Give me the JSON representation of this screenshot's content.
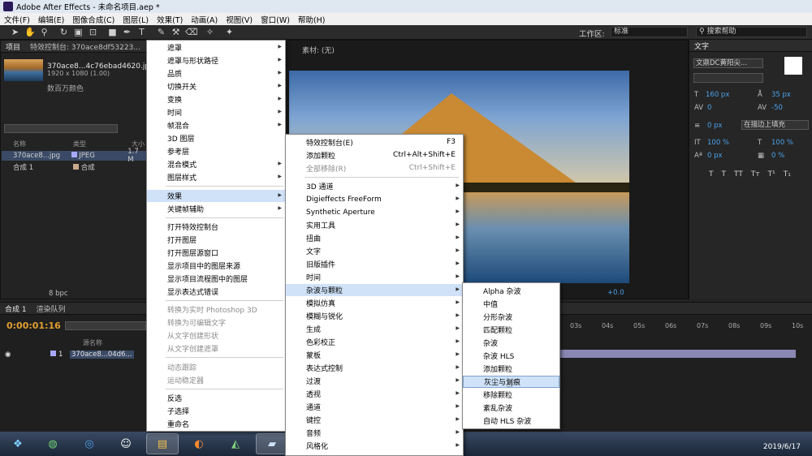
{
  "window": {
    "title": "Adobe After Effects - 未命名项目.aep *"
  },
  "menubar": [
    "文件(F)",
    "编辑(E)",
    "图像合成(C)",
    "图层(L)",
    "效果(T)",
    "动画(A)",
    "视图(V)",
    "窗口(W)",
    "帮助(H)"
  ],
  "toolbar": {
    "workspace_label": "工作区:",
    "workspace_value": "标准",
    "search_help": "搜索帮助"
  },
  "project_panel": {
    "tabs": [
      "项目",
      "特效控制台: 370ace8df53223..."
    ],
    "file_name": "370ace8...4c76ebad4620.jpg ▼, 使用了 1 次",
    "file_dims": "1920 x 1080 (1.00)",
    "color_mode": "数百万颜色",
    "columns": [
      "名称",
      "类型",
      "大小"
    ],
    "items": [
      {
        "name": "370ace8...jpg",
        "type": "JPEG",
        "size": "1.7 M"
      },
      {
        "name": "合成 1",
        "type": "合成",
        "size": ""
      }
    ],
    "bpc": "8 bpc"
  },
  "composition": {
    "footage_label": "素材: (无)",
    "zoom_offset": "+0.0"
  },
  "text_panel": {
    "title": "文字",
    "font": "文鼎DC黄阳尖...",
    "size": "160 px",
    "leading": "35 px",
    "kerning_value": "0",
    "tracking": "-50",
    "stroke_width": "0 px",
    "stroke_mode": "在描边上填充",
    "vscale": "100 %",
    "hscale": "100 %",
    "baseline": "0 px",
    "tsume": "0 %",
    "styles": [
      "T",
      "T",
      "TT",
      "Tт",
      "T¹",
      "T₁"
    ]
  },
  "timeline": {
    "tabs": [
      "合成 1",
      "渲染队列"
    ],
    "timecode": "0:00:01:16",
    "col_source": "源名称",
    "layer_index": "1",
    "layer_name": "370ace8...04d6...",
    "ruler": [
      "03s",
      "04s",
      "05s",
      "06s",
      "07s",
      "08s",
      "09s",
      "10s"
    ]
  },
  "context_menu": [
    {
      "label": "遮罩",
      "arrow": true
    },
    {
      "label": "遮罩与形状路径",
      "arrow": true
    },
    {
      "label": "品质",
      "arrow": true
    },
    {
      "label": "切换开关",
      "arrow": true
    },
    {
      "label": "变换",
      "arrow": true
    },
    {
      "label": "时间",
      "arrow": true
    },
    {
      "label": "帧混合",
      "arrow": true
    },
    {
      "label": "3D 图层",
      "arrow": false
    },
    {
      "label": "参考层",
      "arrow": false
    },
    {
      "label": "混合模式",
      "arrow": true
    },
    {
      "label": "图层样式",
      "arrow": true
    },
    {
      "label": "效果",
      "arrow": true,
      "highlight": true
    },
    {
      "label": "关键帧辅助",
      "arrow": true
    },
    {
      "label": "打开特效控制台",
      "arrow": false
    },
    {
      "label": "打开图层",
      "arrow": false
    },
    {
      "label": "打开图层源窗口",
      "arrow": false
    },
    {
      "label": "显示项目中的图层来源",
      "arrow": false
    },
    {
      "label": "显示项目流程图中的图层",
      "arrow": false
    },
    {
      "label": "显示表达式错误",
      "arrow": false
    },
    {
      "label": "转换为实时 Photoshop 3D",
      "disabled": true
    },
    {
      "label": "转换为可编辑文字",
      "disabled": true
    },
    {
      "label": "从文字创建形状",
      "disabled": true
    },
    {
      "label": "从文字创建遮罩",
      "disabled": true
    },
    {
      "label": "动态跟踪",
      "disabled": true
    },
    {
      "label": "运动稳定器",
      "disabled": true
    },
    {
      "label": "反选"
    },
    {
      "label": "子选择"
    },
    {
      "label": "重命名"
    }
  ],
  "effects_menu": [
    {
      "label": "特效控制台(E)",
      "shortcut": "F3"
    },
    {
      "label": "添加颗粒",
      "shortcut": "Ctrl+Alt+Shift+E"
    },
    {
      "label": "全部移除(R)",
      "shortcut": "Ctrl+Shift+E",
      "disabled": true
    },
    {
      "label": "3D 通道",
      "arrow": true
    },
    {
      "label": "Digieffects FreeForm",
      "arrow": true
    },
    {
      "label": "Synthetic Aperture",
      "arrow": true
    },
    {
      "label": "实用工具",
      "arrow": true
    },
    {
      "label": "扭曲",
      "arrow": true
    },
    {
      "label": "文字",
      "arrow": true
    },
    {
      "label": "旧版插件",
      "arrow": true
    },
    {
      "label": "时间",
      "arrow": true
    },
    {
      "label": "杂波与颗粒",
      "arrow": true,
      "highlight": true
    },
    {
      "label": "模拟仿真",
      "arrow": true
    },
    {
      "label": "模糊与锐化",
      "arrow": true
    },
    {
      "label": "生成",
      "arrow": true
    },
    {
      "label": "色彩校正",
      "arrow": true
    },
    {
      "label": "蒙板",
      "arrow": true
    },
    {
      "label": "表达式控制",
      "arrow": true
    },
    {
      "label": "过渡",
      "arrow": true
    },
    {
      "label": "透视",
      "arrow": true
    },
    {
      "label": "通道",
      "arrow": true
    },
    {
      "label": "键控",
      "arrow": true
    },
    {
      "label": "音频",
      "arrow": true
    },
    {
      "label": "风格化",
      "arrow": true
    }
  ],
  "noise_menu": [
    {
      "label": "Alpha 杂波"
    },
    {
      "label": "中值"
    },
    {
      "label": "分形杂波"
    },
    {
      "label": "匹配颗粒"
    },
    {
      "label": "杂波"
    },
    {
      "label": "杂波 HLS"
    },
    {
      "label": "添加颗粒"
    },
    {
      "label": "灰尘与划痕",
      "highlight": true
    },
    {
      "label": "移除颗粒"
    },
    {
      "label": "紊乱杂波"
    },
    {
      "label": "自动 HLS 杂波"
    }
  ],
  "taskbar": {
    "clock": "2019/6/17"
  }
}
